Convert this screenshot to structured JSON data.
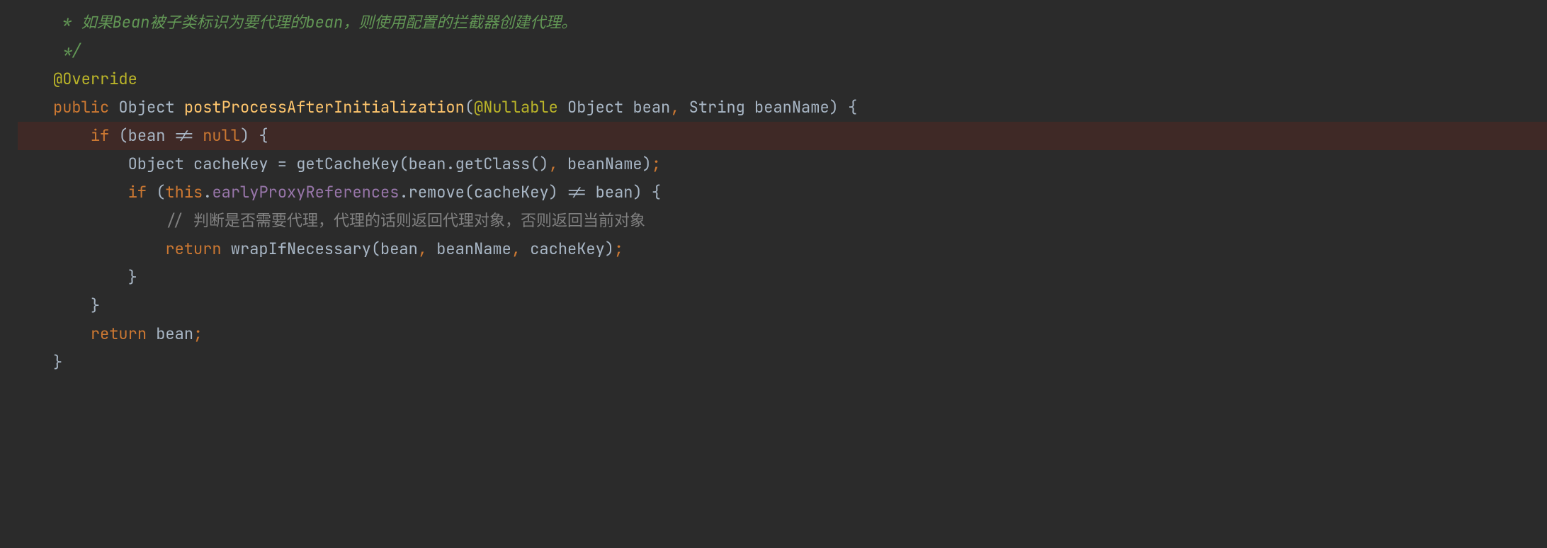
{
  "code": {
    "line1_javadoc": " * 如果Bean被子类标识为要代理的bean，则使用配置的拦截器创建代理。",
    "line2_javadoc": " */",
    "line3_annotation": "@Override",
    "line4_kw_public": "public",
    "line4_type1": " Object ",
    "line4_method": "postProcessAfterInitialization",
    "line4_paren_open": "(",
    "line4_param_anno": "@Nullable",
    "line4_param1": " Object bean",
    "line4_comma": ", ",
    "line4_param2": "String beanName",
    "line4_paren_close": ") {",
    "line5_if": "if",
    "line5_cond_open": " (bean ",
    "line5_ne": "!=",
    "line5_sp": " ",
    "line5_null": "null",
    "line5_cond_close": ") {",
    "line6_text1": "Object cacheKey = getCacheKey(bean.getClass()",
    "line6_comma": ", ",
    "line6_text2": "beanName)",
    "line6_semi": ";",
    "line7_if": "if",
    "line7_open": " (",
    "line7_this": "this",
    "line7_dot": ".",
    "line7_field": "earlyProxyReferences",
    "line7_call": ".remove(cacheKey) ",
    "line7_ne": "!=",
    "line7_rest": " bean) {",
    "line8_comment": "// 判断是否需要代理，代理的话则返回代理对象，否则返回当前对象",
    "line9_return": "return",
    "line9_call": " wrapIfNecessary(bean",
    "line9_c1": ", ",
    "line9_p2": "beanName",
    "line9_c2": ", ",
    "line9_p3": "cacheKey)",
    "line9_semi": ";",
    "line10_brace": "}",
    "line11_brace": "}",
    "line12_return": "return",
    "line12_expr": " bean",
    "line12_semi": ";",
    "line13_brace": "}"
  }
}
